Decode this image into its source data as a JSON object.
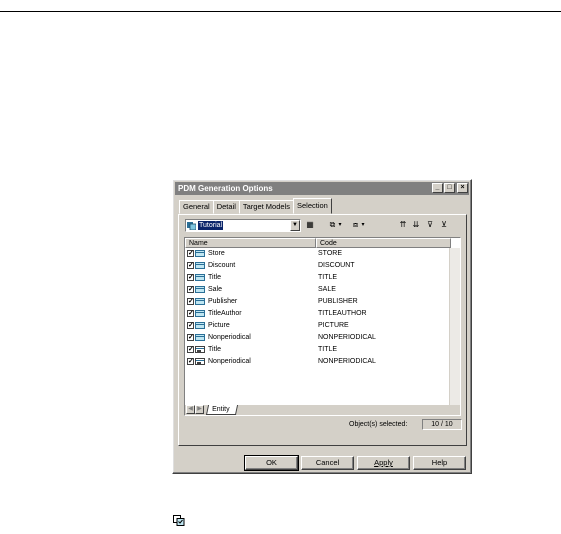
{
  "dialog": {
    "title": "PDM Generation Options",
    "tabs": [
      "General",
      "Detail",
      "Target Models",
      "Selection"
    ],
    "active_tab": "Selection"
  },
  "toolbar": {
    "model_select_value": "Tutorial"
  },
  "grid": {
    "columns": [
      "Name",
      "Code"
    ],
    "rows": [
      {
        "name": "Store",
        "code": "STORE",
        "checked": true,
        "icon": "entity-icon"
      },
      {
        "name": "Discount",
        "code": "DISCOUNT",
        "checked": true,
        "icon": "entity-icon"
      },
      {
        "name": "Title",
        "code": "TITLE",
        "checked": true,
        "icon": "entity-icon"
      },
      {
        "name": "Sale",
        "code": "SALE",
        "checked": true,
        "icon": "entity-icon"
      },
      {
        "name": "Publisher",
        "code": "PUBLISHER",
        "checked": true,
        "icon": "entity-icon"
      },
      {
        "name": "TitleAuthor",
        "code": "TITLEAUTHOR",
        "checked": true,
        "icon": "entity-icon"
      },
      {
        "name": "Picture",
        "code": "PICTURE",
        "checked": true,
        "icon": "entity-icon"
      },
      {
        "name": "Nonperiodical",
        "code": "NONPERIODICAL",
        "checked": true,
        "icon": "entity-icon"
      },
      {
        "name": "Title",
        "code": "TITLE",
        "checked": true,
        "icon": "entity-shortcut-icon"
      },
      {
        "name": "Nonperiodical",
        "code": "NONPERIODICAL",
        "checked": true,
        "icon": "entity-shortcut-icon"
      }
    ],
    "sheet_tab": "Entity"
  },
  "status": {
    "label": "Object(s) selected:",
    "count": "10 / 10"
  },
  "buttons": {
    "ok": "OK",
    "cancel": "Cancel",
    "apply": "Apply",
    "help": "Help"
  }
}
